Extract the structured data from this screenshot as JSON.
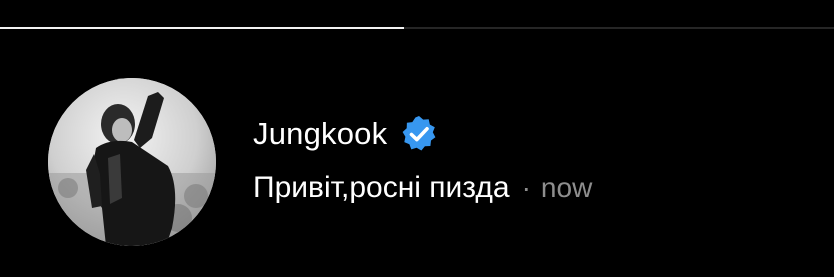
{
  "story": {
    "progress": 0.485,
    "colors": {
      "background": "#000000",
      "progress_fill": "#f2f2f2",
      "progress_track": "#262626",
      "verified_badge": "#3797f0",
      "muted_text": "#8e8e8e"
    }
  },
  "sender": {
    "username": "Jungkook",
    "avatar_icon": "avatar-photo",
    "verified_icon": "verified-badge-icon"
  },
  "message": {
    "text": "Привіт,росні пизда",
    "separator": "·",
    "timestamp": "now"
  }
}
